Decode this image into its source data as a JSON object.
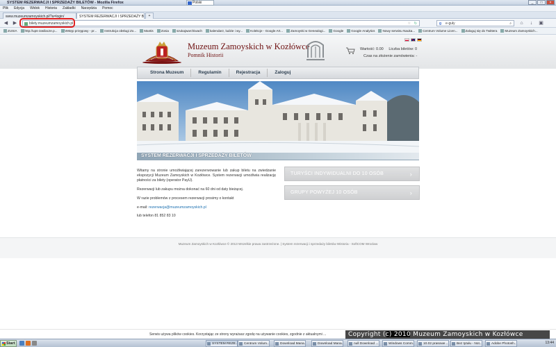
{
  "window": {
    "title": "SYSTEM REZERWACJI I SPRZEDAŻY BILETÓW - Mozilla Firefox",
    "language_indicator": "Polski"
  },
  "menubar": [
    "Plik",
    "Edycja",
    "Widok",
    "Historia",
    "Zakładki",
    "Narzędzia",
    "Pomoc"
  ],
  "tabs": [
    {
      "label": "www.muzeumzamoyskich.pl/?a=login/",
      "active": false
    },
    {
      "label": "SYSTEM REZERWACJI I SPRZEDAŻY BILETÓ...",
      "active": true
    }
  ],
  "navbar": {
    "url": "bilety.muzeumzamoyskich.pl",
    "search_placeholder": "e-guły"
  },
  "bookmarks": [
    "ZUSIA",
    "http://ups-zasilacze.p...",
    "Wstęp przęgowy - pr...",
    "Instrukcja obsługi Zo...",
    "Mantis",
    "Zosia",
    "szukajwarchiwach",
    "kalendarz, ludzie i wy...",
    "Kolekcje - Google Art...",
    "Zamoyski w Genealogi...",
    "Google",
    "Google Analytics",
    "Nowy serwisu Nauka...",
    "Centrum Volume Licen...",
    "Zaloguj się do Twittera",
    "Muzeum Zamoyskich..."
  ],
  "header": {
    "title": "Muzeum Zamoyskich w Kozłówce",
    "subtitle": "Pomnik Historii",
    "cart_value": "Wartość:  0.00",
    "cart_tickets": "Liczba biletów:  0",
    "cart_time": "Czas na złożenie zamówienia: -"
  },
  "mainnav": [
    "Strona Muzeum",
    "Regulamin",
    "Rejestracja",
    "Zaloguj"
  ],
  "section_title": "SYSTEM REZERWACJI I SPRZEDAŻY BILETÓW",
  "content": {
    "intro": "Witamy na stronie umożliwiającej zarezerwowanie lub zakup biletu na zwiedzanie ekspozycji Muzeum Zamoyskich w Kozłówce. System rezerwacji umożliwia realizację płatności za bilety (operator PayU).",
    "advance": "Rezerwacji lub zakupu można dokonać na 60 dni od daty bieżącej.",
    "problems": "W razie problemów z procesem rezerwacji prosimy o kontakt",
    "email_label": "e-mail:",
    "email": "rezerwacja@muzeumzamoyskich.pl",
    "phone": "lub telefon 81 852 83 10"
  },
  "cta": [
    {
      "label": "TURYŚCI INDYWIDUALNI DO 10 OSÓB"
    },
    {
      "label": "GRUPY POWYŻEJ 10 OSÓB"
    }
  ],
  "footer": "Muzeum Zamoyskich w Kozłówce © 2013 Wszelkie prawa zastrzeżone. | System rezerwacji i sprzedaży biletów Wistoria - SoftCOM Wrocław",
  "cookie": "Serwis używa plików cookies. Korzystając ze strony wyrażasz zgodę na używanie cookies, zgodnie z aktualnymi ...",
  "watermark": "Copyright (c) 2010 Muzeum Zamoyskich w Kozłówce",
  "taskbar": {
    "start": "Start",
    "items": [
      "SYSTEM REZE...",
      "Centrum Volum...",
      "Download Mana...",
      "Download Mana...",
      "null Download ...",
      "Windows Comm...",
      "10.02 prasowe ...",
      "Bez tytułu - Not...",
      "Adobe Photosh..."
    ],
    "clock": "13:44"
  },
  "colors": {
    "title_red": "#6e1010",
    "cta_grey": "#d6d7d8",
    "link": "#1a6fb0"
  }
}
